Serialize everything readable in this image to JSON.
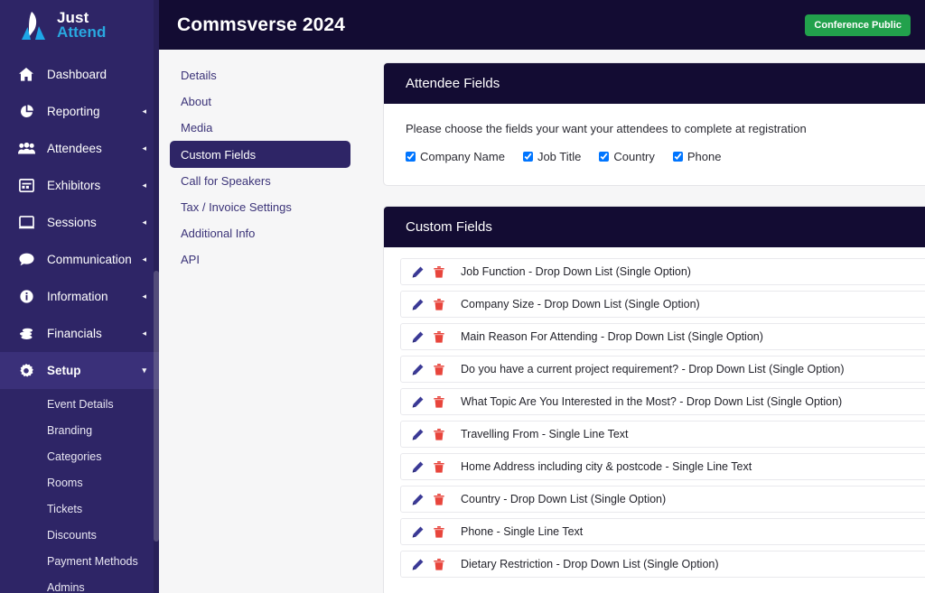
{
  "brand": {
    "line1": "Just",
    "line2": "Attend",
    "logo_icon": "just-attend-logo-icon"
  },
  "sidebar": {
    "items": [
      {
        "label": "Dashboard",
        "icon": "home-icon",
        "caret": "",
        "active": false
      },
      {
        "label": "Reporting",
        "icon": "pie-chart-icon",
        "caret": "◂",
        "active": false
      },
      {
        "label": "Attendees",
        "icon": "users-icon",
        "caret": "◂",
        "active": false
      },
      {
        "label": "Exhibitors",
        "icon": "exhibitors-icon",
        "caret": "◂",
        "active": false
      },
      {
        "label": "Sessions",
        "icon": "presentation-icon",
        "caret": "◂",
        "active": false
      },
      {
        "label": "Communication",
        "icon": "chat-bubble-icon",
        "caret": "◂",
        "active": false
      },
      {
        "label": "Information",
        "icon": "info-circle-icon",
        "caret": "◂",
        "active": false
      },
      {
        "label": "Financials",
        "icon": "coins-icon",
        "caret": "◂",
        "active": false
      },
      {
        "label": "Setup",
        "icon": "gear-icon",
        "caret": "▾",
        "active": true
      }
    ],
    "setup_subitems": [
      {
        "label": "Event Details"
      },
      {
        "label": "Branding"
      },
      {
        "label": "Categories"
      },
      {
        "label": "Rooms"
      },
      {
        "label": "Tickets"
      },
      {
        "label": "Discounts"
      },
      {
        "label": "Payment Methods"
      },
      {
        "label": "Admins"
      }
    ]
  },
  "header": {
    "title": "Commsverse 2024",
    "badge": "Conference Public",
    "badge_color": "#22a14c"
  },
  "section_nav": {
    "items": [
      {
        "label": "Details",
        "active": false
      },
      {
        "label": "About",
        "active": false
      },
      {
        "label": "Media",
        "active": false
      },
      {
        "label": "Custom Fields",
        "active": true
      },
      {
        "label": "Call for Speakers",
        "active": false
      },
      {
        "label": "Tax / Invoice Settings",
        "active": false
      },
      {
        "label": "Additional Info",
        "active": false
      },
      {
        "label": "API",
        "active": false
      }
    ]
  },
  "attendee_fields_panel": {
    "title": "Attendee Fields",
    "description": "Please choose the fields your want your attendees to complete at registration",
    "checkboxes": [
      {
        "label": "Company Name",
        "checked": true
      },
      {
        "label": "Job Title",
        "checked": true
      },
      {
        "label": "Country",
        "checked": true
      },
      {
        "label": "Phone",
        "checked": true
      }
    ]
  },
  "custom_fields_panel": {
    "title": "Custom Fields",
    "edit_icon": "pencil-icon",
    "delete_icon": "trash-icon",
    "rows": [
      {
        "label": "Job Function - Drop Down List (Single Option)"
      },
      {
        "label": "Company Size - Drop Down List (Single Option)"
      },
      {
        "label": "Main Reason For Attending - Drop Down List (Single Option)"
      },
      {
        "label": "Do you have a current project requirement? - Drop Down List (Single Option)"
      },
      {
        "label": "What Topic Are You Interested in the Most? - Drop Down List (Single Option)"
      },
      {
        "label": "Travelling From - Single Line Text"
      },
      {
        "label": "Home Address including city & postcode - Single Line Text"
      },
      {
        "label": "Country - Drop Down List (Single Option)"
      },
      {
        "label": "Phone - Single Line Text"
      },
      {
        "label": "Dietary Restriction - Drop Down List (Single Option)"
      }
    ]
  },
  "colors": {
    "sidebar_bg": "#2e2566",
    "sidebar_active_bg": "#3a3079",
    "header_bg": "#130c33",
    "panel_header_bg": "#130c33",
    "accent_blue": "#29a8e0",
    "edit_icon": "#3b3a96",
    "delete_icon": "#e8453c"
  }
}
